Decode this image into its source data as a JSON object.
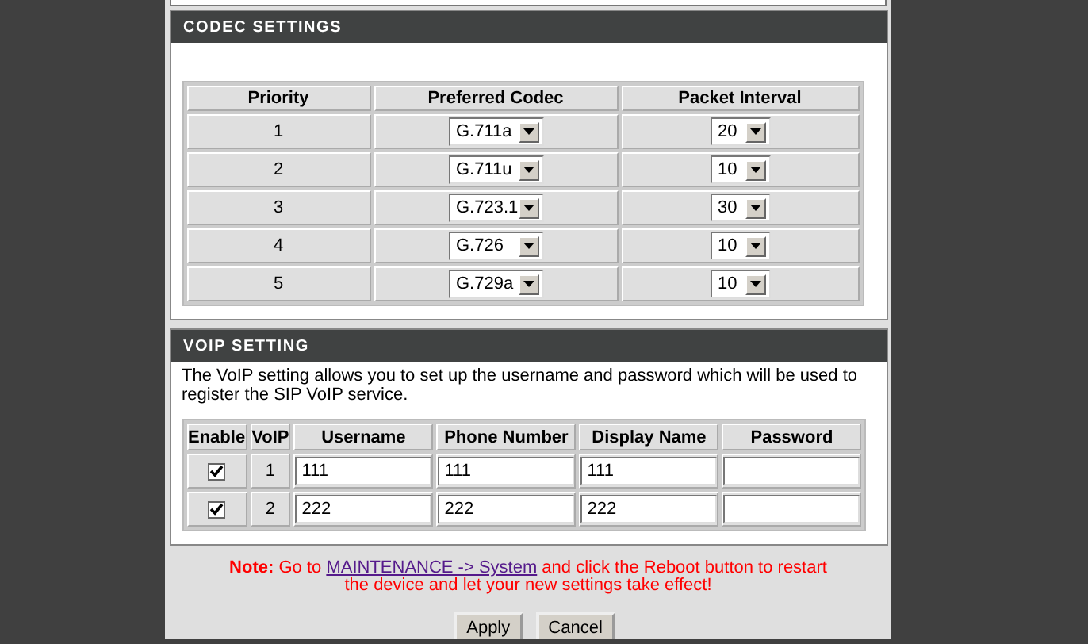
{
  "codec_settings": {
    "title": "CODEC SETTINGS",
    "columns": [
      "Priority",
      "Preferred Codec",
      "Packet Interval"
    ],
    "rows": [
      {
        "priority": "1",
        "codec": "G.711a",
        "interval": "20"
      },
      {
        "priority": "2",
        "codec": "G.711u",
        "interval": "10"
      },
      {
        "priority": "3",
        "codec": "G.723.1",
        "interval": "30"
      },
      {
        "priority": "4",
        "codec": "G.726",
        "interval": "10"
      },
      {
        "priority": "5",
        "codec": "G.729a",
        "interval": "10"
      }
    ]
  },
  "voip_setting": {
    "title": "VOIP SETTING",
    "description": "The VoIP setting allows you to set up the username and password which will be used to register the SIP VoIP service.",
    "columns": [
      "Enable",
      "VoIP",
      "Username",
      "Phone Number",
      "Display Name",
      "Password"
    ],
    "rows": [
      {
        "enable": true,
        "voip": "1",
        "username": "111",
        "phone_number": "111",
        "display_name": "111"
      },
      {
        "enable": true,
        "voip": "2",
        "username": "222",
        "phone_number": "222",
        "display_name": "222"
      }
    ]
  },
  "note": {
    "label": "Note:",
    "before": "Go to ",
    "link": "MAINTENANCE -> System",
    "after": " and click the Reboot button to restart the device and let your new settings take effect!"
  },
  "buttons": [
    "Apply",
    "Cancel"
  ]
}
